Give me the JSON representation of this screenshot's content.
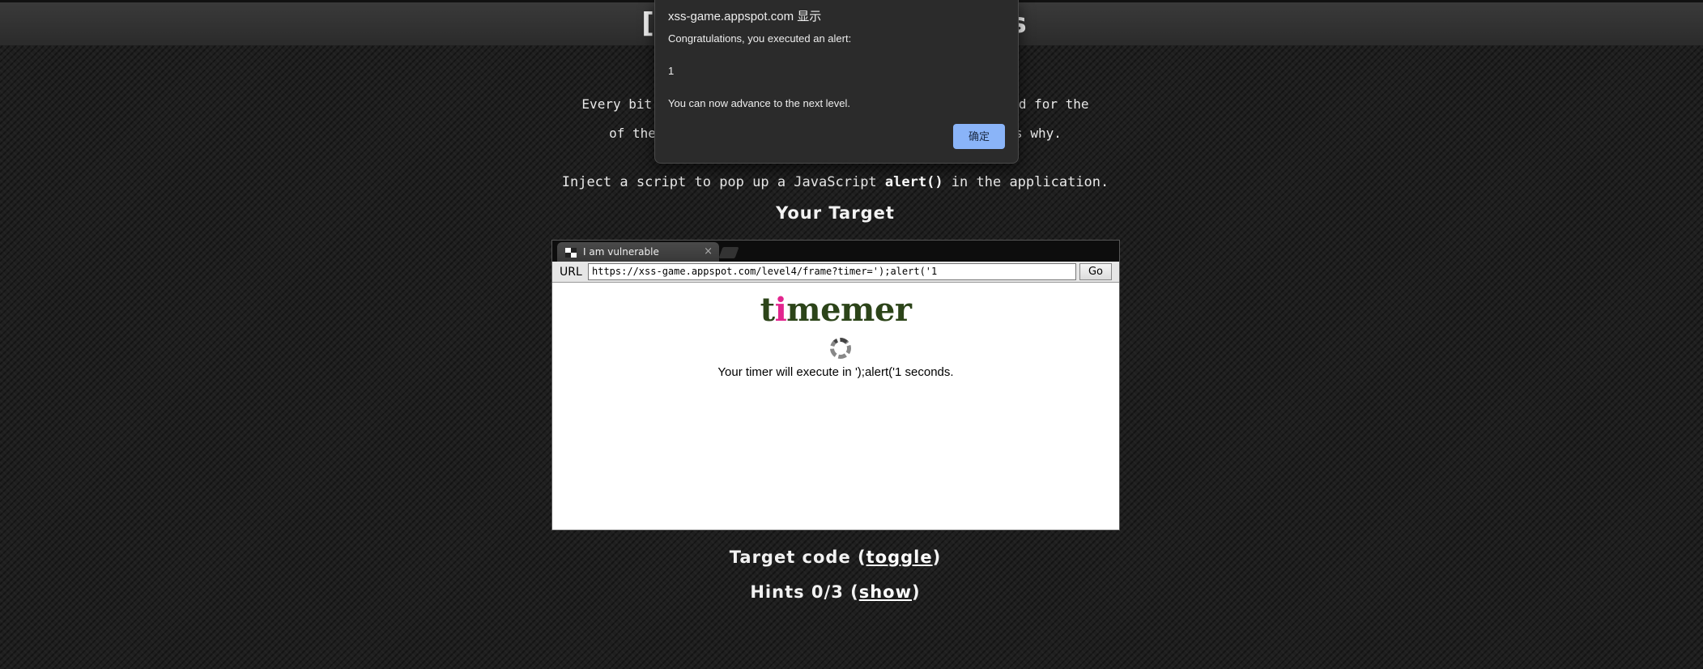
{
  "page": {
    "title": "[4/6] Context matters",
    "mission_text": "Every bit of user-supplied data must be correctly escaped for the context\nof the page in which it will appear. This level shows why.",
    "objective_prefix": "Inject a script to pop up a JavaScript ",
    "objective_code": "alert()",
    "objective_suffix": " in the application.",
    "target_heading": "Your Target",
    "target_code_prefix": "Target code (",
    "target_code_link": "toggle",
    "hints_prefix": "Hints 0/3 (",
    "hints_link": "show",
    "close_paren": ")"
  },
  "browser_frame": {
    "tab_title": "I am vulnerable",
    "tab_close": "×",
    "url_label": "URL",
    "url_value": "https://xss-game.appspot.com/level4/frame?timer=');alert('1",
    "go_label": "Go"
  },
  "app": {
    "logo_part1": "t",
    "logo_highlight": "i",
    "logo_part2": "memer",
    "timer_message": "Your timer will execute in ');alert('1 seconds."
  },
  "alert_dialog": {
    "origin": "xss-game.appspot.com 显示",
    "line1": "Congratulations, you executed an alert:",
    "value": "1",
    "line2": "You can now advance to the next level.",
    "ok_label": "确定"
  },
  "colors": {
    "background": "#1f1f1f",
    "logo_green": "#2c4419",
    "logo_pink": "#e2258e",
    "dialog_bg": "#2b2b2b",
    "ok_button": "#8ab4f8"
  },
  "icons": [
    "favicon-icon",
    "close-icon",
    "new-tab-icon",
    "spinner-icon"
  ]
}
